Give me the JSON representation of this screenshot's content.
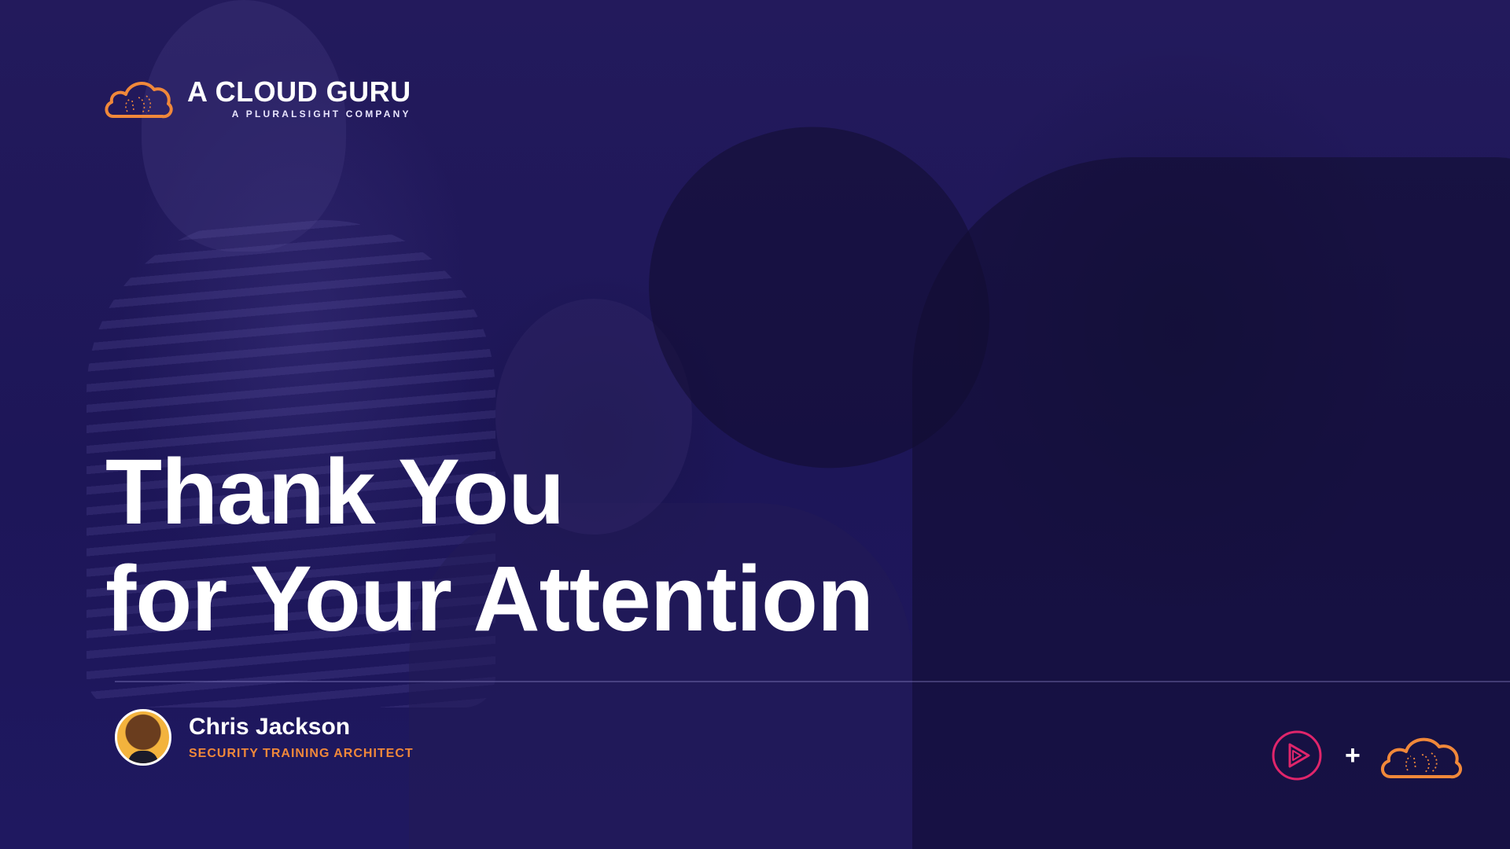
{
  "logo": {
    "title": "A CLOUD GURU",
    "subtitle": "A PLURALSIGHT COMPANY",
    "icon": "cloud-icon"
  },
  "slide": {
    "title_line1": "Thank You",
    "title_line2": "for Your Attention"
  },
  "presenter": {
    "name": "Chris Jackson",
    "role": "SECURITY TRAINING ARCHITECT"
  },
  "brand_combo": {
    "left_icon": "pluralsight-play-icon",
    "separator": "+",
    "right_icon": "cloud-icon"
  },
  "colors": {
    "background": "#1d1658",
    "accent_orange": "#f0883a",
    "pluralsight_pink": "#e0256b",
    "text": "#ffffff"
  }
}
